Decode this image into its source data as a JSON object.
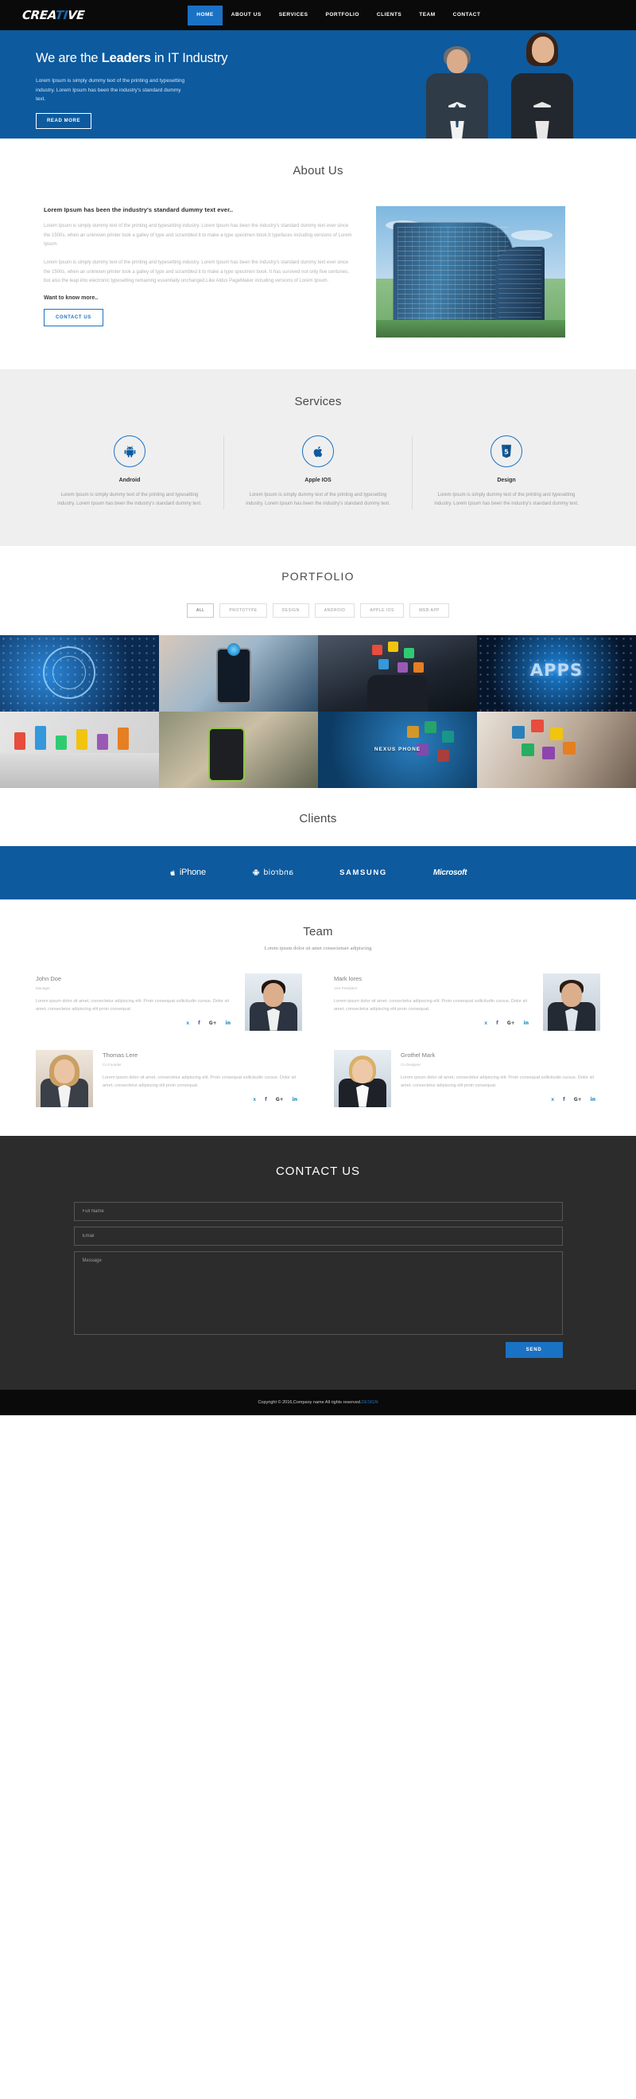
{
  "site": {
    "logo_text_1": "CREA",
    "logo_text_hl": "TI",
    "logo_text_2": "VE"
  },
  "nav": {
    "items": [
      {
        "label": "HOME",
        "active": true
      },
      {
        "label": "ABOUT US",
        "active": false
      },
      {
        "label": "SERVICES",
        "active": false
      },
      {
        "label": "PORTFOLIO",
        "active": false
      },
      {
        "label": "CLIENTS",
        "active": false
      },
      {
        "label": "TEAM",
        "active": false
      },
      {
        "label": "CONTACT",
        "active": false
      }
    ]
  },
  "hero": {
    "title_pre": "We are the ",
    "title_bold": "Leaders",
    "title_post": " in IT Industry",
    "paragraph": "Lorem Ipsum is simply dummy text of the printing and typesetting industry. Lorem Ipsum has been the industry's standard dummy text.",
    "cta_label": "READ MORE",
    "bg_color": "#0d5a9e"
  },
  "about": {
    "title": "About Us",
    "heading": "Lorem Ipsum has been the industry's standard dummy text ever..",
    "paragraph1": "Lorem Ipsum is simply dummy text of the printing and typesetting industry. Lorem Ipsum has been the industry's standard dummy text ever since the 1500s, when an unknown printer took a galley of type and scrambled it to make a type specimen book.It typefaces including versions of Lorem Ipsum.",
    "paragraph2": "Lorem Ipsum is simply dummy text of the printing and typesetting industry. Lorem Ipsum has been the industry's standard dummy text ever since the 1500s, when an unknown printer took a galley of type and scrambled it to make a type specimen book. It has survived not only five centuries, but also the leap into electronic typesetting remaining essentially unchanged.Like Aldus PageMaker including versions of Lorem Ipsum.",
    "ask": "Want to know more..",
    "cta_label": "CONTACT US"
  },
  "services": {
    "title": "Services",
    "items": [
      {
        "icon": "android-icon",
        "name": "Android",
        "desc": "Lorem Ipsum is simply dummy text of the printing and typesetting industry. Lorem Ipsum has been the industry's standard dummy text."
      },
      {
        "icon": "apple-icon",
        "name": "Apple IOS",
        "desc": "Lorem Ipsum is simply dummy text of the printing and typesetting industry. Lorem Ipsum has been the industry's standard dummy text."
      },
      {
        "icon": "html5-icon",
        "name": "Design",
        "desc": "Lorem Ipsum is simply dummy text of the printing and typesetting industry. Lorem Ipsum has been the industry's standard dummy text."
      }
    ]
  },
  "portfolio": {
    "title": "PORTFOLIO",
    "filters": [
      {
        "label": "ALL",
        "active": true
      },
      {
        "label": "PROTOTYPE",
        "active": false
      },
      {
        "label": "DESIGN",
        "active": false
      },
      {
        "label": "ANDROID",
        "active": false
      },
      {
        "label": "APPLE IOS",
        "active": false
      },
      {
        "label": "WEB APP",
        "active": false
      }
    ],
    "items": [
      {
        "caption": "",
        "style": "tile-1"
      },
      {
        "caption": "",
        "style": "tile-2"
      },
      {
        "caption": "",
        "style": "tile-3"
      },
      {
        "caption": "APPS",
        "style": "tile-4"
      },
      {
        "caption": "",
        "style": "tile-5"
      },
      {
        "caption": "",
        "style": "tile-6"
      },
      {
        "caption": "NEXUS PHONE",
        "style": "tile-7"
      },
      {
        "caption": "",
        "style": "tile-8"
      }
    ]
  },
  "clients": {
    "title": "Clients",
    "bar_color": "#0d5a9e",
    "logos": [
      {
        "name": "iPhone",
        "id": "iphone"
      },
      {
        "name": "android",
        "id": "android"
      },
      {
        "name": "SAMSUNG",
        "id": "samsung"
      },
      {
        "name": "Microsoft",
        "id": "microsoft"
      }
    ]
  },
  "team": {
    "title": "Team",
    "subtitle": "Lorem ipsum dolor sit amet consectetuer adipiscing",
    "members": [
      {
        "name": "John Doe",
        "role": "Manager",
        "desc": "Lorem ipsum dolor sit amet, consectetur adipiscing elit. Proin consequat sollicitudin cursus. Dolor sit amet, consectetur adipiscing elit proin consequat.",
        "photo_side": "right",
        "social": [
          "twitter",
          "facebook",
          "google-plus",
          "linkedin"
        ]
      },
      {
        "name": "Mark lores",
        "role": "Vice President",
        "desc": "Lorem ipsum dolor sit amet, consectetur adipiscing elit. Proin consequat sollicitudin cursus. Dolor sit amet, consectetur adipiscing elit proin consequat.",
        "photo_side": "right",
        "social": [
          "twitter",
          "facebook",
          "google-plus",
          "linkedin"
        ]
      },
      {
        "name": "Thomas Lere",
        "role": "Co Founder",
        "desc": "Lorem ipsum dolor sit amet, consectetur adipiscing elit. Proin consequat sollicitudin cursus. Dolor sit amet, consectetur adipiscing elit proin consequat.",
        "photo_side": "left",
        "social": [
          "twitter",
          "facebook",
          "google-plus",
          "linkedin"
        ]
      },
      {
        "name": "Grothel Mark",
        "role": "Co Designer",
        "desc": "Lorem ipsum dolor sit amet, consectetur adipiscing elit. Proin consequat sollicitudin cursus. Dolor sit amet, consectetur adipiscing elit proin consequat.",
        "photo_side": "left",
        "social": [
          "twitter",
          "facebook",
          "google-plus",
          "linkedin"
        ]
      }
    ]
  },
  "contact": {
    "title": "CONTACT US",
    "name_placeholder": "Full Name",
    "name_value": "",
    "email_placeholder": "Email",
    "email_value": "",
    "message_placeholder": "Message",
    "message_value": "",
    "send_label": "SEND",
    "send_color": "#1a72c4"
  },
  "footer": {
    "text": "Copyright © 2016,Company name All rights reserved.",
    "link": "DESIGN"
  }
}
